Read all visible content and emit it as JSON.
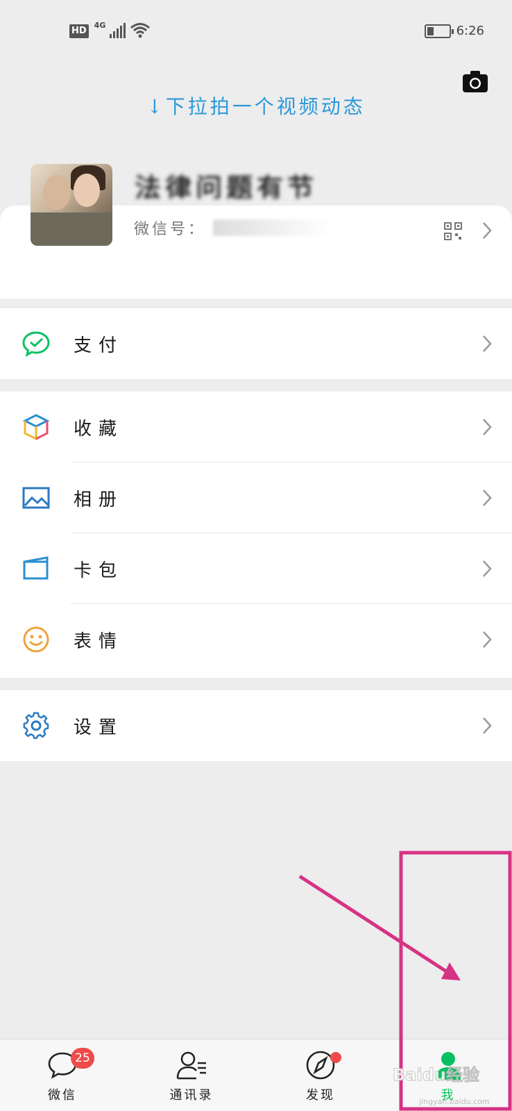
{
  "status_bar": {
    "hd_label": "HD",
    "network_label": "4G",
    "time": "6:26",
    "battery_level": 0.3
  },
  "header": {
    "pull_hint": "↓下拉拍一个视频动态",
    "camera_icon": "camera-icon"
  },
  "profile": {
    "nickname": "法律问题有节",
    "wechat_id_label": "微信号：",
    "qr_icon": "qr-code-icon"
  },
  "menu": {
    "pay": {
      "label": "支付",
      "icon": "wechat-pay-icon",
      "color": "#07c160"
    },
    "favorites": {
      "label": "收藏",
      "icon": "favorites-cube-icon"
    },
    "album": {
      "label": "相册",
      "icon": "photo-album-icon",
      "color": "#2a7ac2"
    },
    "cards": {
      "label": "卡包",
      "icon": "card-wallet-icon",
      "color": "#2a8fd0"
    },
    "stickers": {
      "label": "表情",
      "icon": "sticker-smile-icon",
      "color": "#f0a23a"
    },
    "settings": {
      "label": "设置",
      "icon": "settings-gear-icon",
      "color": "#2a7ac2"
    }
  },
  "tabbar": {
    "tabs": [
      {
        "label": "微信",
        "icon": "chat-bubble-icon",
        "badge": "25"
      },
      {
        "label": "通讯录",
        "icon": "contacts-icon"
      },
      {
        "label": "发现",
        "icon": "discover-compass-icon"
      },
      {
        "label": "我",
        "icon": "me-person-icon",
        "active": true
      }
    ]
  },
  "overlay": {
    "watermark": "Baidu经验",
    "watermark_sub": "jingyan.baidu.com",
    "highlight_color": "#d63384"
  }
}
